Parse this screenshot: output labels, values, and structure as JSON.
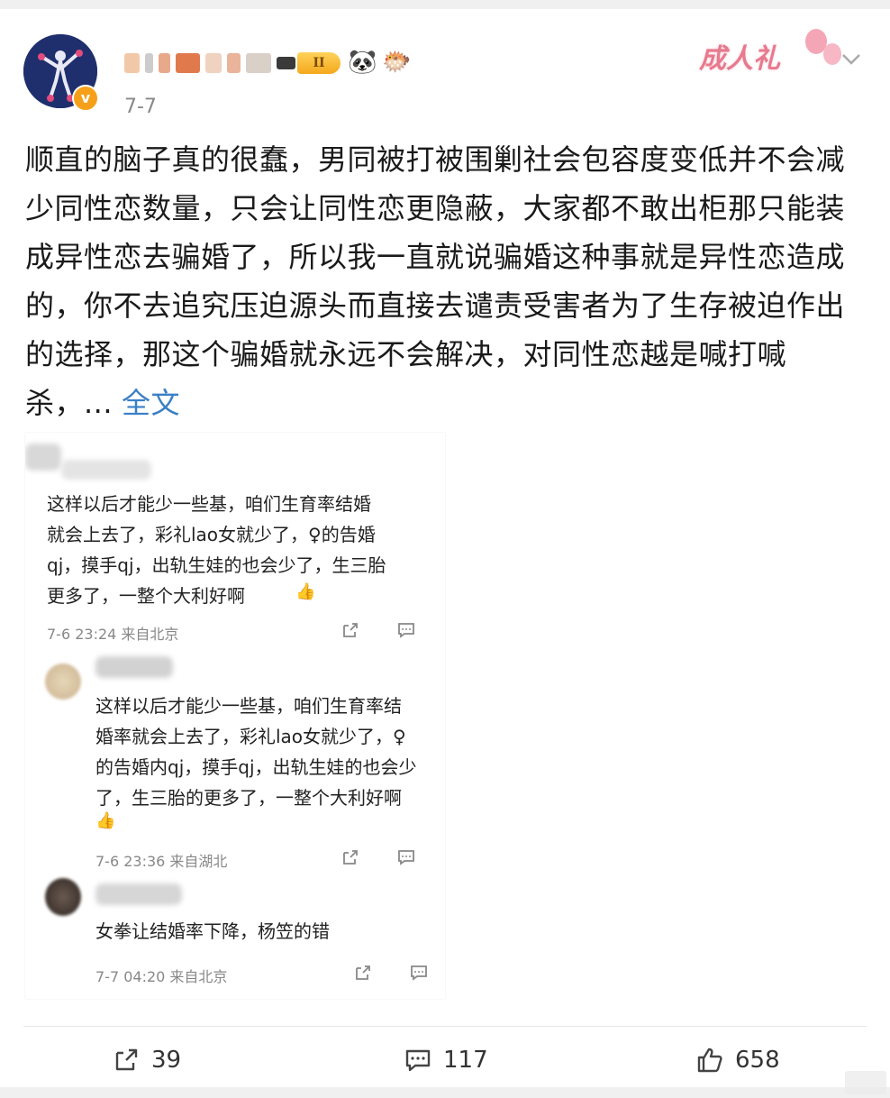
{
  "post": {
    "date": "7-7",
    "level_badge": "II",
    "event_badge": "成人礼",
    "text": "顺直的脑子真的很蠢，男同被打被围剿社会包容度变低并不会减少同性恋数量，只会让同性恋更隐蔽，大家都不敢出柜那只能装成异性恋去骗婚了，所以我一直就说骗婚这种事就是异性恋造成的，你不去追究压迫源头而直接去谴责受害者为了生存被迫作出的选择，那这个骗婚就永远不会解决，对同性恋越是喊打喊杀，...",
    "more_label": "全文"
  },
  "embedded_comments": [
    {
      "lines": [
        "这样以后才能少一些基，咱们生育率结婚",
        "就会上去了，彩礼lao女就少了，♀的告婚",
        "qj，摸手qj，出轨生娃的也会少了，生三胎",
        "更多了，一整个大利好啊"
      ],
      "meta": "7-6 23:24 来自北京"
    },
    {
      "lines": [
        "这样以后才能少一些基，咱们生育率结",
        "婚率就会上去了，彩礼lao女就少了，♀",
        "的告婚内qj，摸手qj，出轨生娃的也会少",
        "了，生三胎的更多了，一整个大利好啊"
      ],
      "meta": "7-6 23:36 来自湖北"
    },
    {
      "lines": [
        "女拳让结婚率下降，杨笠的错"
      ],
      "meta": "7-7 04:20 来自北京"
    }
  ],
  "actions": {
    "share_count": "39",
    "comment_count": "117",
    "like_count": "658"
  },
  "colors": {
    "link": "#3a7fc6",
    "muted": "#888888",
    "badge": "#f4a81c"
  },
  "icons": [
    "share-icon",
    "comment-icon",
    "like-icon",
    "chevron-down-icon",
    "verified-icon",
    "panda-icon",
    "fish-icon"
  ]
}
